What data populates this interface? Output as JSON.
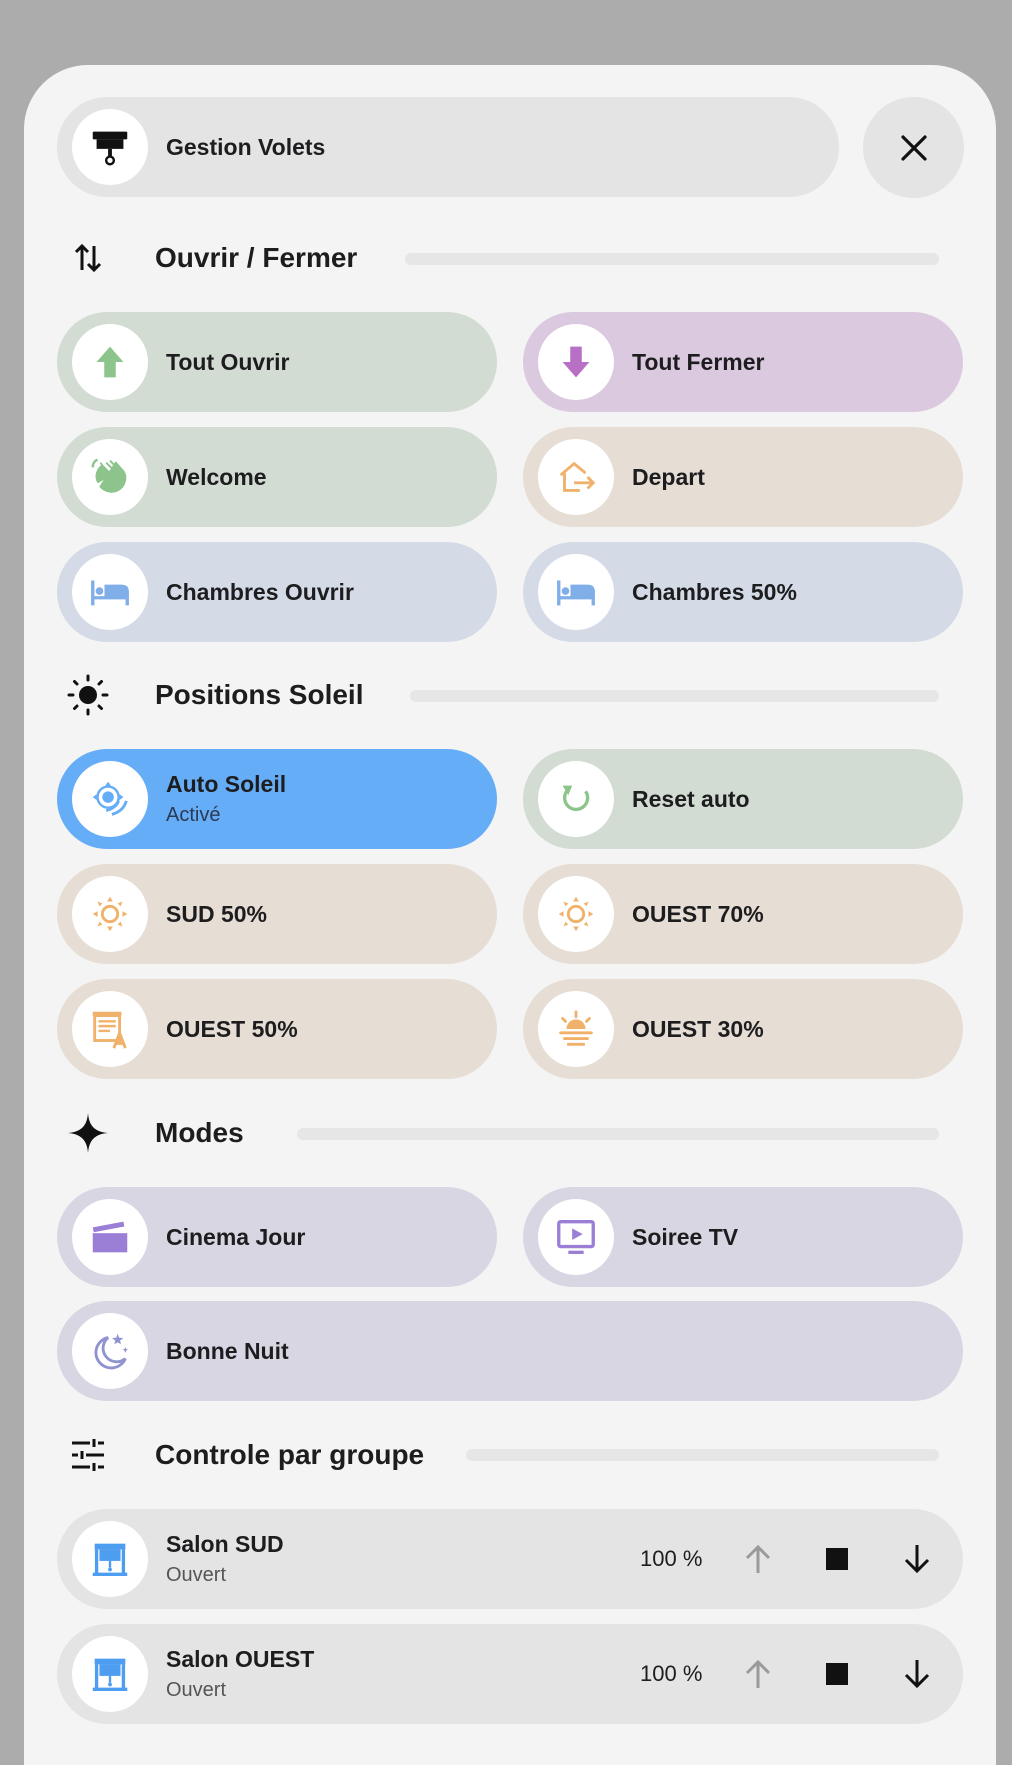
{
  "header": {
    "title": "Gestion Volets",
    "close_icon": "close-icon",
    "icon": "blinds-icon"
  },
  "sections": {
    "open_close": {
      "title": "Ouvrir / Fermer",
      "icon": "swap-vertical-icon"
    },
    "sun": {
      "title": "Positions Soleil",
      "icon": "sun-icon"
    },
    "modes": {
      "title": "Modes",
      "icon": "sparkle-icon"
    },
    "group": {
      "title": "Controle par groupe",
      "icon": "tune-icon"
    }
  },
  "buttons": {
    "open_all": {
      "label": "Tout Ouvrir",
      "icon": "arrow-up-icon",
      "color": "#8cc48c"
    },
    "close_all": {
      "label": "Tout Fermer",
      "icon": "arrow-down-icon",
      "color": "#b86fc6"
    },
    "welcome": {
      "label": "Welcome",
      "icon": "hand-wave-icon",
      "color": "#8cc48c"
    },
    "depart": {
      "label": "Depart",
      "icon": "home-export-icon",
      "color": "#f0b26a"
    },
    "rooms_open": {
      "label": "Chambres Ouvrir",
      "icon": "bed-icon",
      "color": "#7faee8"
    },
    "rooms_50": {
      "label": "Chambres 50%",
      "icon": "bed-icon",
      "color": "#7faee8"
    },
    "auto_sun": {
      "label": "Auto Soleil",
      "state": "Activé",
      "icon": "sun-auto-icon",
      "color": "#66adf7"
    },
    "reset_auto": {
      "label": "Reset auto",
      "icon": "restore-icon",
      "color": "#8cc48c"
    },
    "south_50": {
      "label": "SUD 50%",
      "icon": "sun-outline-icon",
      "color": "#f0b26a"
    },
    "west_70": {
      "label": "OUEST 70%",
      "icon": "sun-outline-icon",
      "color": "#f0b26a"
    },
    "west_50": {
      "label": "OUEST 50%",
      "icon": "blinds-text-icon",
      "color": "#f0b26a"
    },
    "west_30": {
      "label": "OUEST 30%",
      "icon": "sun-lines-icon",
      "color": "#f0b26a"
    },
    "cinema": {
      "label": "Cinema Jour",
      "icon": "movie-clapper-icon",
      "color": "#9b7fd6"
    },
    "tv": {
      "label": "Soiree TV",
      "icon": "tv-play-icon",
      "color": "#9b7fd6"
    },
    "night": {
      "label": "Bonne Nuit",
      "icon": "moon-star-icon",
      "color": "#8f94d0"
    }
  },
  "covers": [
    {
      "name": "Salon SUD",
      "state": "Ouvert",
      "position": "100 %",
      "icon": "window-shutter-open-icon"
    },
    {
      "name": "Salon OUEST",
      "state": "Ouvert",
      "position": "100 %",
      "icon": "window-shutter-open-icon"
    }
  ]
}
